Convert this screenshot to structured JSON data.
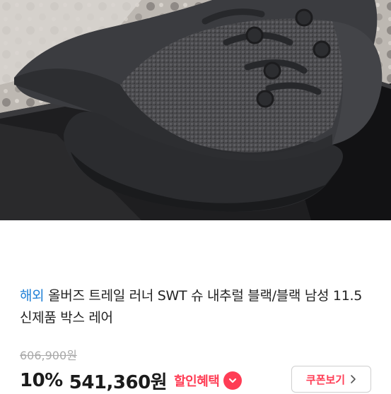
{
  "product": {
    "image": {
      "description_icon": "sneaker-photo"
    },
    "region_tag": "해외",
    "title": "올버즈 트레일 러너 SWT 슈 내추럴 블랙/블랙 남성 11.5 신제품 박스 레어",
    "original_price": "606,900원",
    "discount_rate": "10%",
    "sale_price": "541,360원",
    "benefit_label": "할인혜택",
    "coupon_button_label": "쿠폰보기"
  },
  "colors": {
    "accent_red": "#ff3d55",
    "tag_blue": "#1e7fd6"
  }
}
